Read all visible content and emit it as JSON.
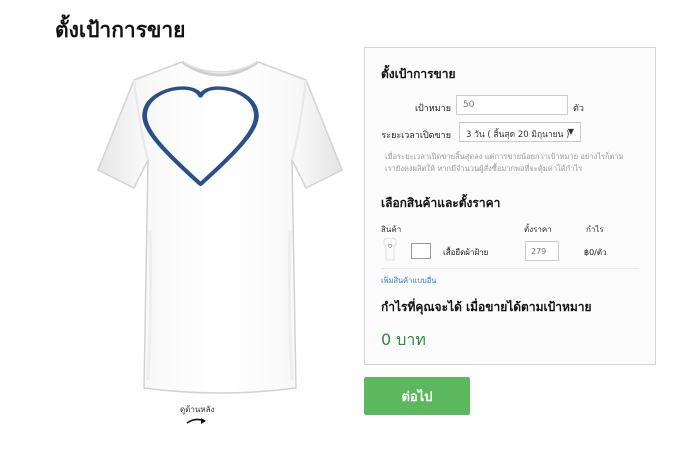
{
  "page": {
    "title": "ตั้งเป้าการขาย"
  },
  "preview": {
    "back_view_label": "ดูด้านหลัง"
  },
  "goal_panel": {
    "heading": "ตั้งเป้าการขาย",
    "goal_label": "เป้าหมาย",
    "goal_value": "50",
    "goal_unit": "ตัว",
    "duration_label": "ระยะเวลาเปิดขาย",
    "duration_value": "3 วัน ( สิ้นสุด 20 มิถุนายน )",
    "note": "เมื่อระยะเวลาเปิดขายสิ้นสุดลง แต่การขายน้อยกว่าเป้าหมาย อย่างไรก็ตาม เรายังคงผลิตให้ หากมีจำนวนผู้สั่งซื้อมากพอที่จะคุ้มค่าได้กำไร"
  },
  "product_section": {
    "heading": "เลือกสินค้าและตั้งราคา",
    "columns": {
      "product": "สินค้า",
      "price": "ตั้งราคา",
      "profit": "กำไร"
    },
    "items": [
      {
        "name": "เสื้อยืดผ้าฝ้าย",
        "price": "279",
        "profit": "฿0/ตัว"
      }
    ],
    "add_more_link": "เพิ่มสินค้าแบบอื่น"
  },
  "profit_section": {
    "heading": "กำไรที่คุณจะได้ เมื่อขายได้ตามเป้าหมาย",
    "value": "0 บาท"
  },
  "actions": {
    "next_label": "ต่อไป"
  },
  "colors": {
    "accent_green": "#5cb85c",
    "profit_green": "#2f8a3e",
    "heart_blue": "#2c4f86",
    "link_blue": "#3a7bbf"
  },
  "icons": {
    "heart": "heart-icon",
    "back_arrow": "curved-arrow-icon",
    "select_caret": "caret-down-icon"
  }
}
